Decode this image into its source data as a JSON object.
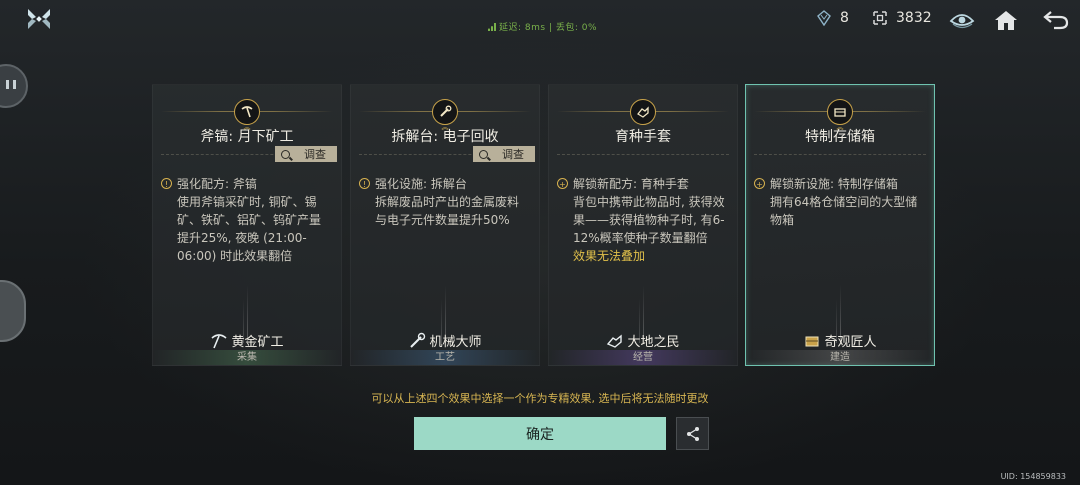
{
  "topbar": {
    "net_status": "延迟: 8ms | 丢包: 0%",
    "resource_a": "8",
    "resource_b": "3832"
  },
  "cards": [
    {
      "title": "斧镐: 月下矿工",
      "inspect": "调查",
      "effect": "强化配方: 斧镐",
      "lines": "使用斧镐采矿时, 铜矿、锡矿、铁矿、铝矿、钨矿产量提升25%, 夜晚 (21:00-06:00) 时此效果翻倍",
      "warning": "",
      "tag": "黄金矿工",
      "category": "采集",
      "selected": false
    },
    {
      "title": "拆解台: 电子回收",
      "inspect": "调查",
      "effect": "强化设施: 拆解台",
      "lines": "拆解废品时产出的金属废料与电子元件数量提升50%",
      "warning": "",
      "tag": "机械大师",
      "category": "工艺",
      "selected": false
    },
    {
      "title": "育种手套",
      "inspect": "",
      "effect": "解锁新配方: 育种手套",
      "lines": "背包中携带此物品时, 获得效果——获得植物种子时, 有6-12%概率使种子数量翻倍",
      "warning": "效果无法叠加",
      "tag": "大地之民",
      "category": "经营",
      "selected": false
    },
    {
      "title": "特制存储箱",
      "inspect": "",
      "effect": "解锁新设施: 特制存储箱",
      "lines": "拥有64格仓储空间的大型储物箱",
      "warning": "",
      "tag": "奇观匠人",
      "category": "建造",
      "selected": true
    }
  ],
  "hint": "可以从上述四个效果中选择一个作为专精效果, 选中后将无法随时更改",
  "confirm_label": "确定",
  "uid": "UID: 154859833",
  "icons": [
    "app-logo-icon",
    "gem-icon",
    "token-icon",
    "eye-emblem-icon",
    "home-icon",
    "back-icon",
    "share-icon",
    "pickaxe-icon",
    "wrench-icon",
    "glove-icon",
    "chest-icon"
  ],
  "colors": {
    "accent": "#9cd9c6",
    "selected_border": "#6fc3b0",
    "gold": "#d6b14f",
    "net": "#79b04a"
  }
}
